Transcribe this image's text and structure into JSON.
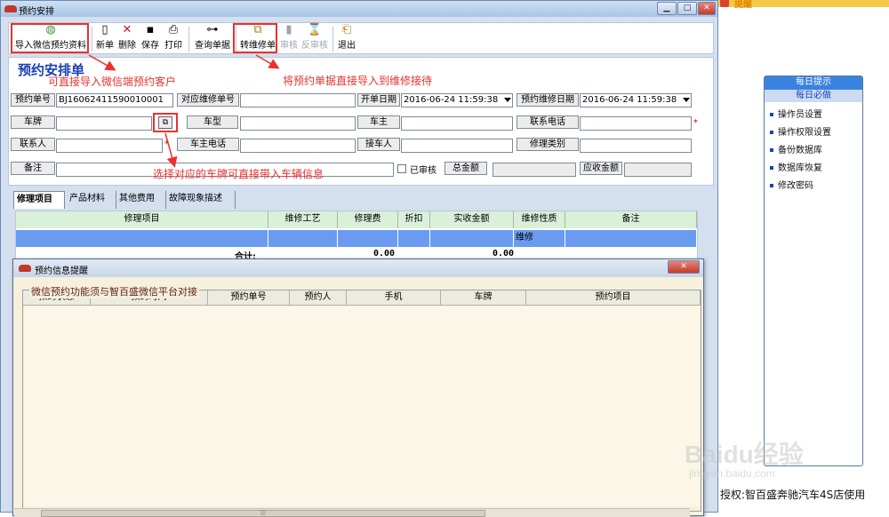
{
  "window": {
    "title": "预约安排"
  },
  "toolbar": {
    "items": [
      {
        "label": "导入微信预约资料",
        "icon": "wechat-import-icon",
        "glyph": "◍",
        "disabled": false
      },
      {
        "label": "新单",
        "icon": "new-document-icon",
        "glyph": "▯",
        "disabled": false
      },
      {
        "label": "删除",
        "icon": "delete-x-icon",
        "glyph": "✕",
        "disabled": false
      },
      {
        "label": "保存",
        "icon": "save-disk-icon",
        "glyph": "▪",
        "disabled": false
      },
      {
        "label": "打印",
        "icon": "printer-icon",
        "glyph": "⎙",
        "disabled": false
      },
      {
        "label": "查询单据",
        "icon": "binoculars-icon",
        "glyph": "⊶",
        "disabled": false
      },
      {
        "label": "转维修单",
        "icon": "convert-repair-icon",
        "glyph": "⧉",
        "disabled": false
      },
      {
        "label": "审核",
        "icon": "audit-icon",
        "glyph": "▮",
        "disabled": true
      },
      {
        "label": "反审核",
        "icon": "unaudit-icon",
        "glyph": "⌛",
        "disabled": true
      },
      {
        "label": "退出",
        "icon": "exit-door-icon",
        "glyph": "⎗",
        "disabled": false
      }
    ]
  },
  "form": {
    "title": "预约安排单",
    "booking_no_label": "预约单号",
    "booking_no_value": "BJ16062411590010001",
    "repair_no_label": "对应维修单号",
    "repair_no_value": "",
    "open_date_label": "开单日期",
    "open_date_value": "2016-06-24 11:59:38",
    "repair_date_label": "预约维修日期",
    "repair_date_value": "2016-06-24 11:59:38",
    "plate_label": "车牌",
    "model_label": "车型",
    "owner_label": "车主",
    "phone_label": "联系电话",
    "contact_label": "联系人",
    "owner_phone_label": "车主电话",
    "receiver_label": "接车人",
    "repair_type_label": "修理类别",
    "remark_label": "备注",
    "audited_label": "已审核",
    "total_label": "总金额",
    "receivable_label": "应收金额",
    "required_mark": "*"
  },
  "tabs": [
    "修理项目",
    "产品材料",
    "其他费用",
    "故障现象描述"
  ],
  "grid": {
    "headers": [
      "修理项目",
      "维修工艺",
      "修理费",
      "折扣",
      "实收金额",
      "维修性质",
      "备注"
    ],
    "row": [
      "",
      "",
      "",
      "",
      "",
      "维修",
      ""
    ],
    "total_label": "合计:",
    "total_fee": "0.00",
    "total_received": "0.00"
  },
  "dialog": {
    "title": "预约信息提醒",
    "group_caption": "微信预约功能须与智百盛微信平台对接",
    "headers": [
      "预约状态",
      "预约时间",
      "预约单号",
      "预约人",
      "手机",
      "车牌",
      "预约项目"
    ],
    "scroll_grip": "|||"
  },
  "annotations": {
    "import_note": "可直接导入微信端预约客户",
    "convert_note": "将预约单据直接导入到维修接待",
    "plate_note": "选择对应的车牌可直接带入车辆信息"
  },
  "right_panel": {
    "top_text": "提醒",
    "tips_title": "每日提示",
    "tips_subtitle": "每日必做",
    "tips": [
      "操作员设置",
      "操作权限设置",
      "备份数据库",
      "数据库恢复",
      "修改密码"
    ],
    "license": "授权:智百盛奔驰汽车4S店使用"
  },
  "watermark": {
    "text": "Baidu经验",
    "sub": "jingyan.baidu.com"
  },
  "colors": {
    "annotation": "#e8322e",
    "title_blue": "#1c3fb6",
    "grid_row": "#6b9bf0",
    "grid_header": "#d9f0d9"
  }
}
